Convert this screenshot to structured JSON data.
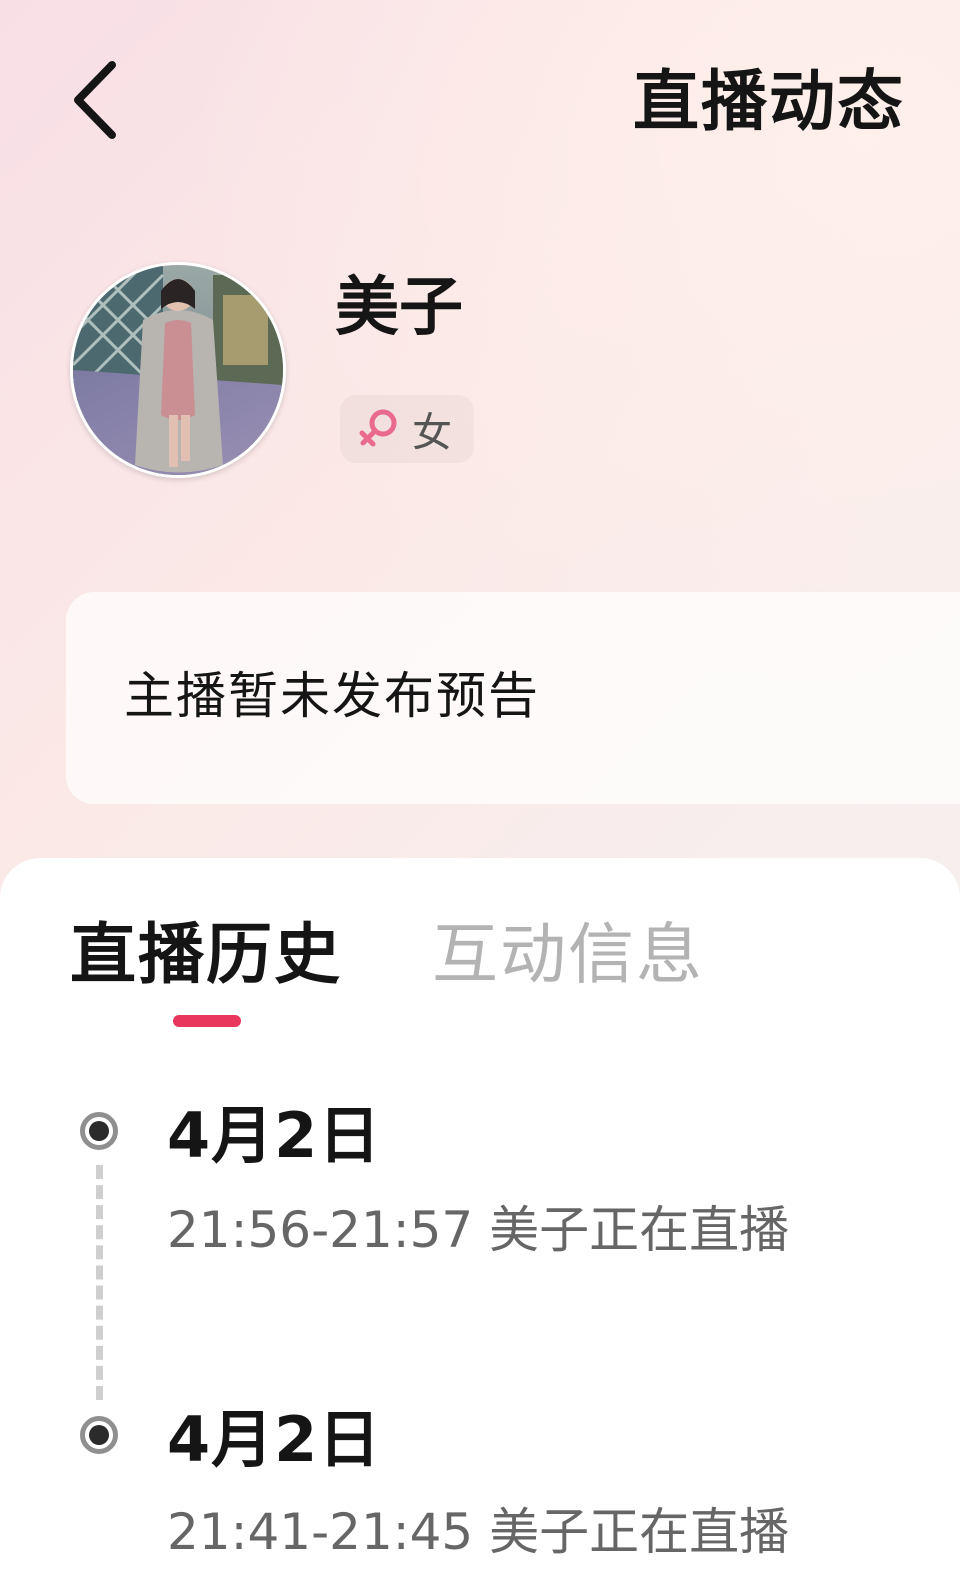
{
  "header": {
    "title": "直播动态",
    "back_icon": "chevron-left-icon"
  },
  "profile": {
    "username": "美子",
    "gender_label": "女",
    "gender_icon": "female-symbol-icon",
    "gender_color": "#e96a8c"
  },
  "notice": {
    "text": "主播暂未发布预告"
  },
  "tabs": [
    {
      "label": "直播历史",
      "active": true
    },
    {
      "label": "互动信息",
      "active": false
    }
  ],
  "accent_color": "#e8365d",
  "timeline": [
    {
      "date": "4月2日",
      "description": "21:56-21:57 美子正在直播"
    },
    {
      "date": "4月2日",
      "description": "21:41-21:45 美子正在直播"
    }
  ]
}
